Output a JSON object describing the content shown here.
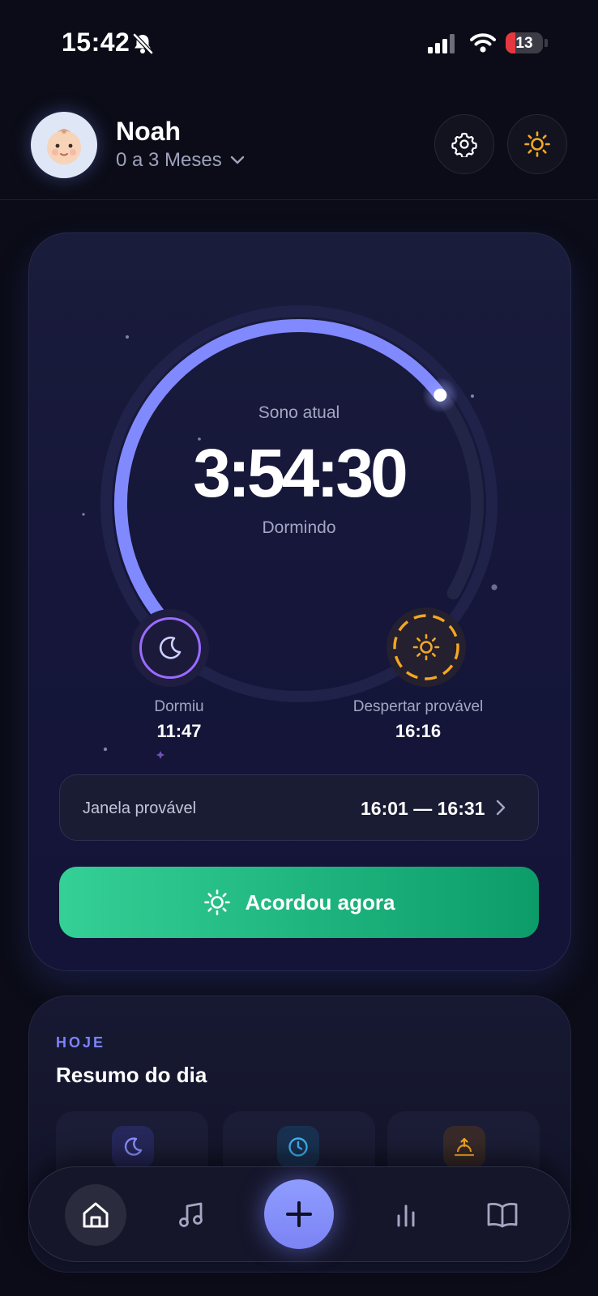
{
  "status_bar": {
    "time": "15:42",
    "battery": "13"
  },
  "header": {
    "name": "Noah",
    "age_range": "0 a 3 Meses"
  },
  "sleep": {
    "label": "Sono atual",
    "elapsed": "3:54:30",
    "state": "Dormindo",
    "progress": 0.74,
    "slept_label": "Dormiu",
    "slept_time": "11:47",
    "wake_label": "Despertar provável",
    "wake_time": "16:16",
    "window_label": "Janela provável",
    "window_range": "16:01 — 16:31",
    "wake_button": "Acordou agora"
  },
  "summary": {
    "kicker": "HOJE",
    "title": "Resumo do dia"
  },
  "icons": {
    "avatar": "baby-emoji",
    "settings": "gear-icon",
    "theme": "sun-icon",
    "slept": "moon-icon",
    "wake": "sun-icon",
    "summary": [
      "moon-icon",
      "clock-icon",
      "sunrise-icon"
    ],
    "nav": [
      "home-icon",
      "music-icon",
      "plus-icon",
      "bar-chart-icon",
      "book-icon"
    ]
  },
  "colors": {
    "background": "#0b0c17",
    "accent": "#8189ff",
    "moon_ring": "#9a6bff",
    "sun": "#f5a623",
    "wake_button_start": "#34d096",
    "wake_button_end": "#0c9c6a",
    "kicker": "#7b83ff"
  }
}
